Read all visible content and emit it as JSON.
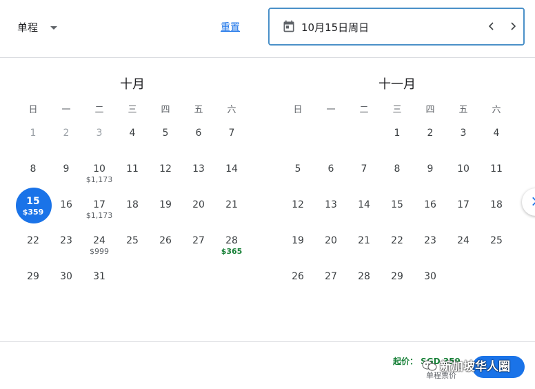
{
  "header": {
    "trip_type": "单程",
    "reset_label": "重置",
    "selected_date": "10月15日周日"
  },
  "weekdays": [
    "日",
    "一",
    "二",
    "三",
    "四",
    "五",
    "六"
  ],
  "months": [
    {
      "title": "十月",
      "first_weekday": 0,
      "days": [
        {
          "d": "1",
          "muted": true
        },
        {
          "d": "2",
          "muted": true
        },
        {
          "d": "3",
          "muted": true
        },
        {
          "d": "4"
        },
        {
          "d": "5"
        },
        {
          "d": "6"
        },
        {
          "d": "7"
        },
        {
          "d": "8"
        },
        {
          "d": "9"
        },
        {
          "d": "10",
          "price": "$1,173"
        },
        {
          "d": "11"
        },
        {
          "d": "12"
        },
        {
          "d": "13"
        },
        {
          "d": "14"
        },
        {
          "d": "15",
          "price": "$359",
          "selected": true
        },
        {
          "d": "16"
        },
        {
          "d": "17",
          "price": "$1,173"
        },
        {
          "d": "18"
        },
        {
          "d": "19"
        },
        {
          "d": "20"
        },
        {
          "d": "21"
        },
        {
          "d": "22"
        },
        {
          "d": "23"
        },
        {
          "d": "24",
          "price": "$999"
        },
        {
          "d": "25"
        },
        {
          "d": "26"
        },
        {
          "d": "27"
        },
        {
          "d": "28",
          "price": "$365",
          "low": true
        },
        {
          "d": "29"
        },
        {
          "d": "30"
        },
        {
          "d": "31"
        }
      ]
    },
    {
      "title": "十一月",
      "first_weekday": 3,
      "days": [
        {
          "d": "1"
        },
        {
          "d": "2"
        },
        {
          "d": "3"
        },
        {
          "d": "4"
        },
        {
          "d": "5"
        },
        {
          "d": "6"
        },
        {
          "d": "7"
        },
        {
          "d": "8"
        },
        {
          "d": "9"
        },
        {
          "d": "10"
        },
        {
          "d": "11"
        },
        {
          "d": "12"
        },
        {
          "d": "13"
        },
        {
          "d": "14"
        },
        {
          "d": "15"
        },
        {
          "d": "16"
        },
        {
          "d": "17"
        },
        {
          "d": "18"
        },
        {
          "d": "19"
        },
        {
          "d": "20"
        },
        {
          "d": "21"
        },
        {
          "d": "22"
        },
        {
          "d": "23"
        },
        {
          "d": "24"
        },
        {
          "d": "25"
        },
        {
          "d": "26"
        },
        {
          "d": "27"
        },
        {
          "d": "28"
        },
        {
          "d": "29"
        },
        {
          "d": "30"
        }
      ]
    }
  ],
  "footer": {
    "price_from": "起价： SGD 359",
    "price_sub": "单程票价"
  },
  "watermark": "新加坡华人圈",
  "colors": {
    "accent": "#1a73e8",
    "low_price": "#188038",
    "field_border": "#4a90c8"
  }
}
